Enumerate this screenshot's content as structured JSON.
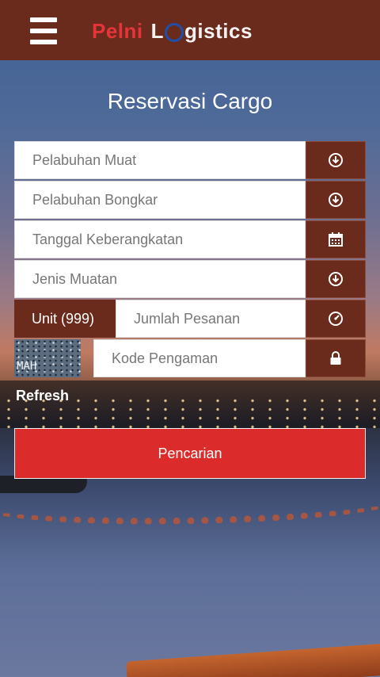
{
  "header": {
    "logo": {
      "part1": "Pelni",
      "part2": "L",
      "part3": "gistics"
    }
  },
  "page_title": "Reservasi Cargo",
  "form": {
    "port_load": {
      "placeholder": "Pelabuhan Muat",
      "icon": "arrow-circle-down-icon"
    },
    "port_unload": {
      "placeholder": "Pelabuhan Bongkar",
      "icon": "arrow-circle-down-icon"
    },
    "departure_date": {
      "placeholder": "Tanggal Keberangkatan",
      "icon": "calendar-icon"
    },
    "cargo_type": {
      "placeholder": "Jenis Muatan",
      "icon": "arrow-circle-down-icon"
    },
    "quantity": {
      "unit_label": "Unit (999)",
      "placeholder": "Jumlah Pesanan",
      "icon": "gauge-icon"
    },
    "security_code": {
      "captcha_text": "MAH",
      "placeholder": "Kode Pengaman",
      "icon": "lock-icon"
    }
  },
  "refresh_label": "Refresh",
  "search_button": "Pencarian",
  "colors": {
    "header_bg": "#6a2a1c",
    "accent_red": "#db2b2b",
    "logo_red": "#e6353a",
    "logo_blue": "#1f4fa8"
  }
}
